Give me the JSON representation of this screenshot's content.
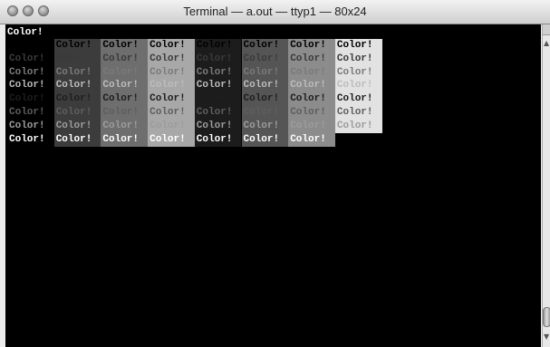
{
  "window": {
    "title": "Terminal — a.out — ttyp1 — 80x24"
  },
  "terminal": {
    "first_line": "Color!",
    "cell_text": "Color!",
    "rows": [
      [
        null,
        "#000000",
        "#000000",
        "#000000",
        "#000000",
        "#000000",
        "#000000",
        "#000000"
      ],
      [
        "#3a3a3a",
        "#3a3a3a",
        "#3a3a3a",
        "#3a3a3a",
        "#3a3a3a",
        "#3a3a3a",
        "#3a3a3a",
        "#3a3a3a"
      ],
      [
        "#7a7a7a",
        "#7a7a7a",
        "#7a7a7a",
        "#7a7a7a",
        "#7a7a7a",
        "#7a7a7a",
        "#7a7a7a",
        "#7a7a7a"
      ],
      [
        "#bcbcbc",
        "#bcbcbc",
        "#bcbcbc",
        "#bcbcbc",
        "#bcbcbc",
        "#bcbcbc",
        "#bcbcbc",
        "#bcbcbc"
      ],
      [
        "#1e1e1e",
        "#1e1e1e",
        "#1e1e1e",
        "#1e1e1e",
        "#1e1e1e",
        "#1e1e1e",
        "#1e1e1e",
        "#1e1e1e"
      ],
      [
        "#5e5e5e",
        "#5e5e5e",
        "#5e5e5e",
        "#5e5e5e",
        "#5e5e5e",
        "#5e5e5e",
        "#5e5e5e",
        "#5e5e5e"
      ],
      [
        "#9c9c9c",
        "#9c9c9c",
        "#9c9c9c",
        "#9c9c9c",
        "#9c9c9c",
        "#9c9c9c",
        "#9c9c9c",
        "#9c9c9c"
      ],
      [
        "#ffffff",
        "#ffffff",
        "#ffffff",
        "#ffffff",
        "#ffffff",
        "#ffffff",
        "#ffffff",
        null
      ]
    ],
    "backgrounds": [
      "#000000",
      "#3c3c3c",
      "#6e6e6e",
      "#a8a8a8",
      "#1c1c1c",
      "#555555",
      "#8c8c8c",
      "#e2e2e2"
    ],
    "hidden_cells": [
      [
        0,
        0
      ],
      [
        7,
        7
      ]
    ]
  },
  "colors": {
    "terminal_bg": "#000000",
    "titlebar": "#d8d8d8"
  }
}
